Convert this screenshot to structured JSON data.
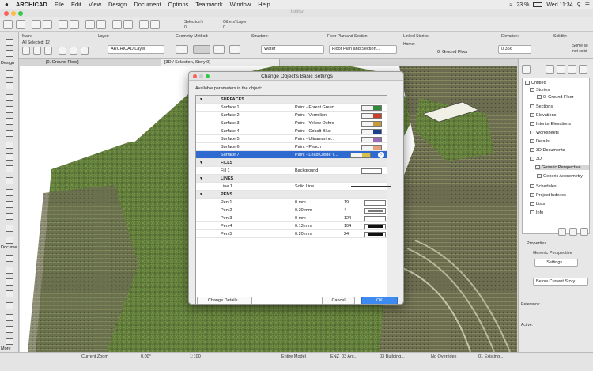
{
  "menubar": {
    "items": [
      "ARCHICAD",
      "File",
      "Edit",
      "View",
      "Design",
      "Document",
      "Options",
      "Teamwork",
      "Window",
      "Help"
    ],
    "battery": "23 %",
    "clock": "Wed 11:34"
  },
  "window": {
    "title": "Untitled"
  },
  "toolbar": {
    "selections_label": "Selection's",
    "selections_count": "0",
    "others_layer_label": "Others' Layer:",
    "others_layer_count": "0"
  },
  "infobox": {
    "main_label": "Main:",
    "selection_summary": "All Selected: 12",
    "layer_label": "Layer:",
    "layer_value": "ARCHICAD Layer",
    "geometry_label": "Geometry Method:",
    "structure_label": "Structure:",
    "structure_value": "Water",
    "floorplan_label": "Floor Plan and Section:",
    "floorplan_value": "Floor Plan and Section...",
    "linked_label": "Linked Stories:",
    "home_label": "Home:",
    "home_value": "0. Ground Floor",
    "elevation_label": "Elevation:",
    "elevation_value": "0,356",
    "solidity_label": "Solidity:",
    "solidity_value_1": "Some se",
    "solidity_value_2": "not solid"
  },
  "tabs": [
    "[0. Ground Floor]",
    "[3D / Selection, Story 0]"
  ],
  "toolbox": {
    "design_label": "Design",
    "document_label": "Docume",
    "more_label": "More"
  },
  "dialog": {
    "title": "Change Object's Basic Settings",
    "params_label": "Available parameters in the object:",
    "groups": {
      "surfaces": "SURFACES",
      "fills": "FILLS",
      "lines": "LINES",
      "pens": "PENS"
    },
    "surfaces": [
      {
        "name": "Surface 1",
        "value": "Paint - Forest Green",
        "color": "#2f8a3a"
      },
      {
        "name": "Surface 2",
        "value": "Paint - Vermilion",
        "color": "#c73f2a"
      },
      {
        "name": "Surface 3",
        "value": "Paint - Yellow Ochre",
        "color": "#c89a3c"
      },
      {
        "name": "Surface 4",
        "value": "Paint - Cobalt Blue",
        "color": "#1c3f8c"
      },
      {
        "name": "Surface 5",
        "value": "Paint - Ultramarine...",
        "color": "#9a6ab8"
      },
      {
        "name": "Surface 6",
        "value": "Paint - Peach",
        "color": "#e7a07e"
      },
      {
        "name": "Surface 7",
        "value": "Paint - Lead Oxide Y...",
        "color": "#d6c24a"
      }
    ],
    "fills": [
      {
        "name": "Fill 1",
        "value": "Background"
      }
    ],
    "lines": [
      {
        "name": "Line 1",
        "value": "Solid Line"
      }
    ],
    "pens": [
      {
        "name": "Pen 1",
        "value": "0 mm",
        "num": "19",
        "color": "#ffffff"
      },
      {
        "name": "Pen 2",
        "value": "0.20 mm",
        "num": "4",
        "color": "#777777"
      },
      {
        "name": "Pen 3",
        "value": "0 mm",
        "num": "124",
        "color": "#ffffff"
      },
      {
        "name": "Pen 4",
        "value": "0.13 mm",
        "num": "104",
        "color": "#111111"
      },
      {
        "name": "Pen 5",
        "value": "0.20 mm",
        "num": "24",
        "color": "#111111"
      }
    ],
    "change_details_label": "Change Details...",
    "cancel_label": "Cancel",
    "ok_label": "OK"
  },
  "navigator": {
    "tree": [
      {
        "label": "Untitled",
        "indent": 0
      },
      {
        "label": "Stories",
        "indent": 1
      },
      {
        "label": "0. Ground Floor",
        "indent": 2
      },
      {
        "label": "Sections",
        "indent": 1
      },
      {
        "label": "Elevations",
        "indent": 1
      },
      {
        "label": "Interior Elevations",
        "indent": 1
      },
      {
        "label": "Worksheets",
        "indent": 1
      },
      {
        "label": "Details",
        "indent": 1
      },
      {
        "label": "3D Documents",
        "indent": 1
      },
      {
        "label": "3D",
        "indent": 1
      },
      {
        "label": "Generic Perspective",
        "indent": 2
      },
      {
        "label": "Generic Axonometry",
        "indent": 2
      },
      {
        "label": "Schedules",
        "indent": 1
      },
      {
        "label": "Project Indexes",
        "indent": 1
      },
      {
        "label": "Lists",
        "indent": 1
      },
      {
        "label": "Info",
        "indent": 1
      }
    ],
    "properties_label": "Properties",
    "properties_value": "Generic Perspective",
    "settings_label": "Settings...",
    "below_story_label": "Below Current Story",
    "reference_label": "Reference:",
    "active_label": "Active:"
  },
  "statusbar": {
    "zoom": "Current Zoom",
    "angle": "0,00°",
    "scale": "1:100",
    "model": "Entire Model",
    "view_set": "ENZ_03 Arc...",
    "layer_combo": "03 Building...",
    "overrides": "No Overrides",
    "renovation": "01 Existing..."
  },
  "colors": {
    "accent": "#2f6ad0",
    "mesh_green": "#5f7a3a"
  }
}
